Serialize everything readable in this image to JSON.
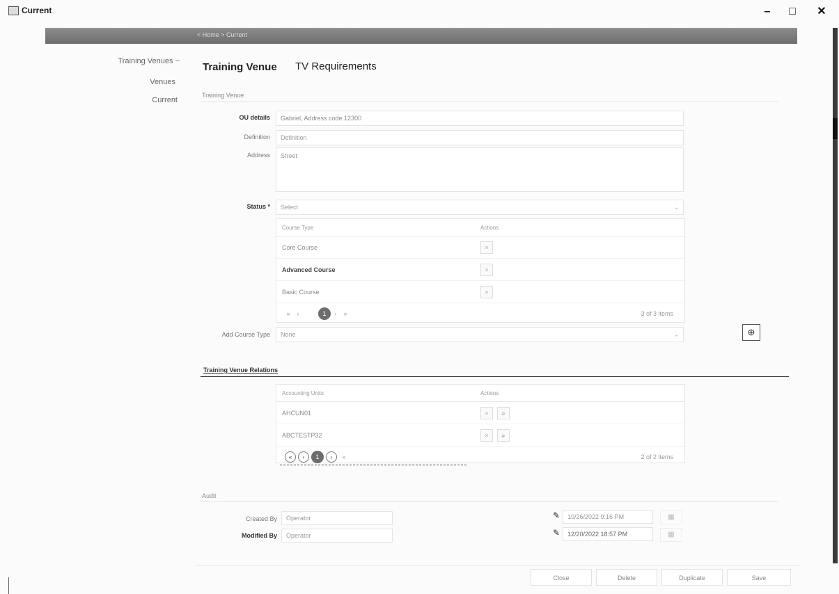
{
  "window": {
    "title": "Current",
    "minimize": "–",
    "maximize": "□",
    "close": "✕"
  },
  "breadcrumb": "< Home > Current",
  "sidebar": {
    "items": [
      {
        "label": "Training Venues ~"
      },
      {
        "label": "Venues"
      },
      {
        "label": "Current"
      }
    ]
  },
  "tabs": [
    {
      "label": "Training Venue"
    },
    {
      "label": "TV Requirements"
    }
  ],
  "training_venue": {
    "section_title": "Training Venue",
    "ou_details_label": "OU details",
    "ou_details_value": "Gabriel, Address code 12300",
    "definition_label": "Definition",
    "definition_value": "Definition",
    "address_label": "Address",
    "address_value": "Street",
    "status_label": "Status *",
    "status_value": "Select",
    "course_grid": {
      "headers": [
        "Course Type",
        "Actions"
      ],
      "rows": [
        {
          "name": "Core Course",
          "bold": false
        },
        {
          "name": "Advanced Course",
          "bold": true
        },
        {
          "name": "Basic Course",
          "bold": false
        }
      ],
      "page": "1",
      "count": "3 of 3 items"
    },
    "add_course_label": "Add Course Type",
    "add_course_value": "None"
  },
  "relations": {
    "section_title": "Training Venue Relations",
    "headers": [
      "Accounting Units",
      "Actions"
    ],
    "rows": [
      {
        "name": "AHCUN01"
      },
      {
        "name": "ABCTESTP32"
      }
    ],
    "page": "1",
    "count": "2 of 2 items"
  },
  "audit": {
    "section_title": "Audit",
    "created_by_label": "Created By",
    "created_by_value": "Operator",
    "modified_by_label": "Modified By",
    "modified_by_value": "Operator",
    "created_date": "10/26/2022 9:16 PM",
    "modified_date": "12/20/2022 18:57 PM"
  },
  "footer": {
    "close": "Close",
    "delete": "Delete",
    "duplicate": "Duplicate",
    "save": "Save"
  }
}
